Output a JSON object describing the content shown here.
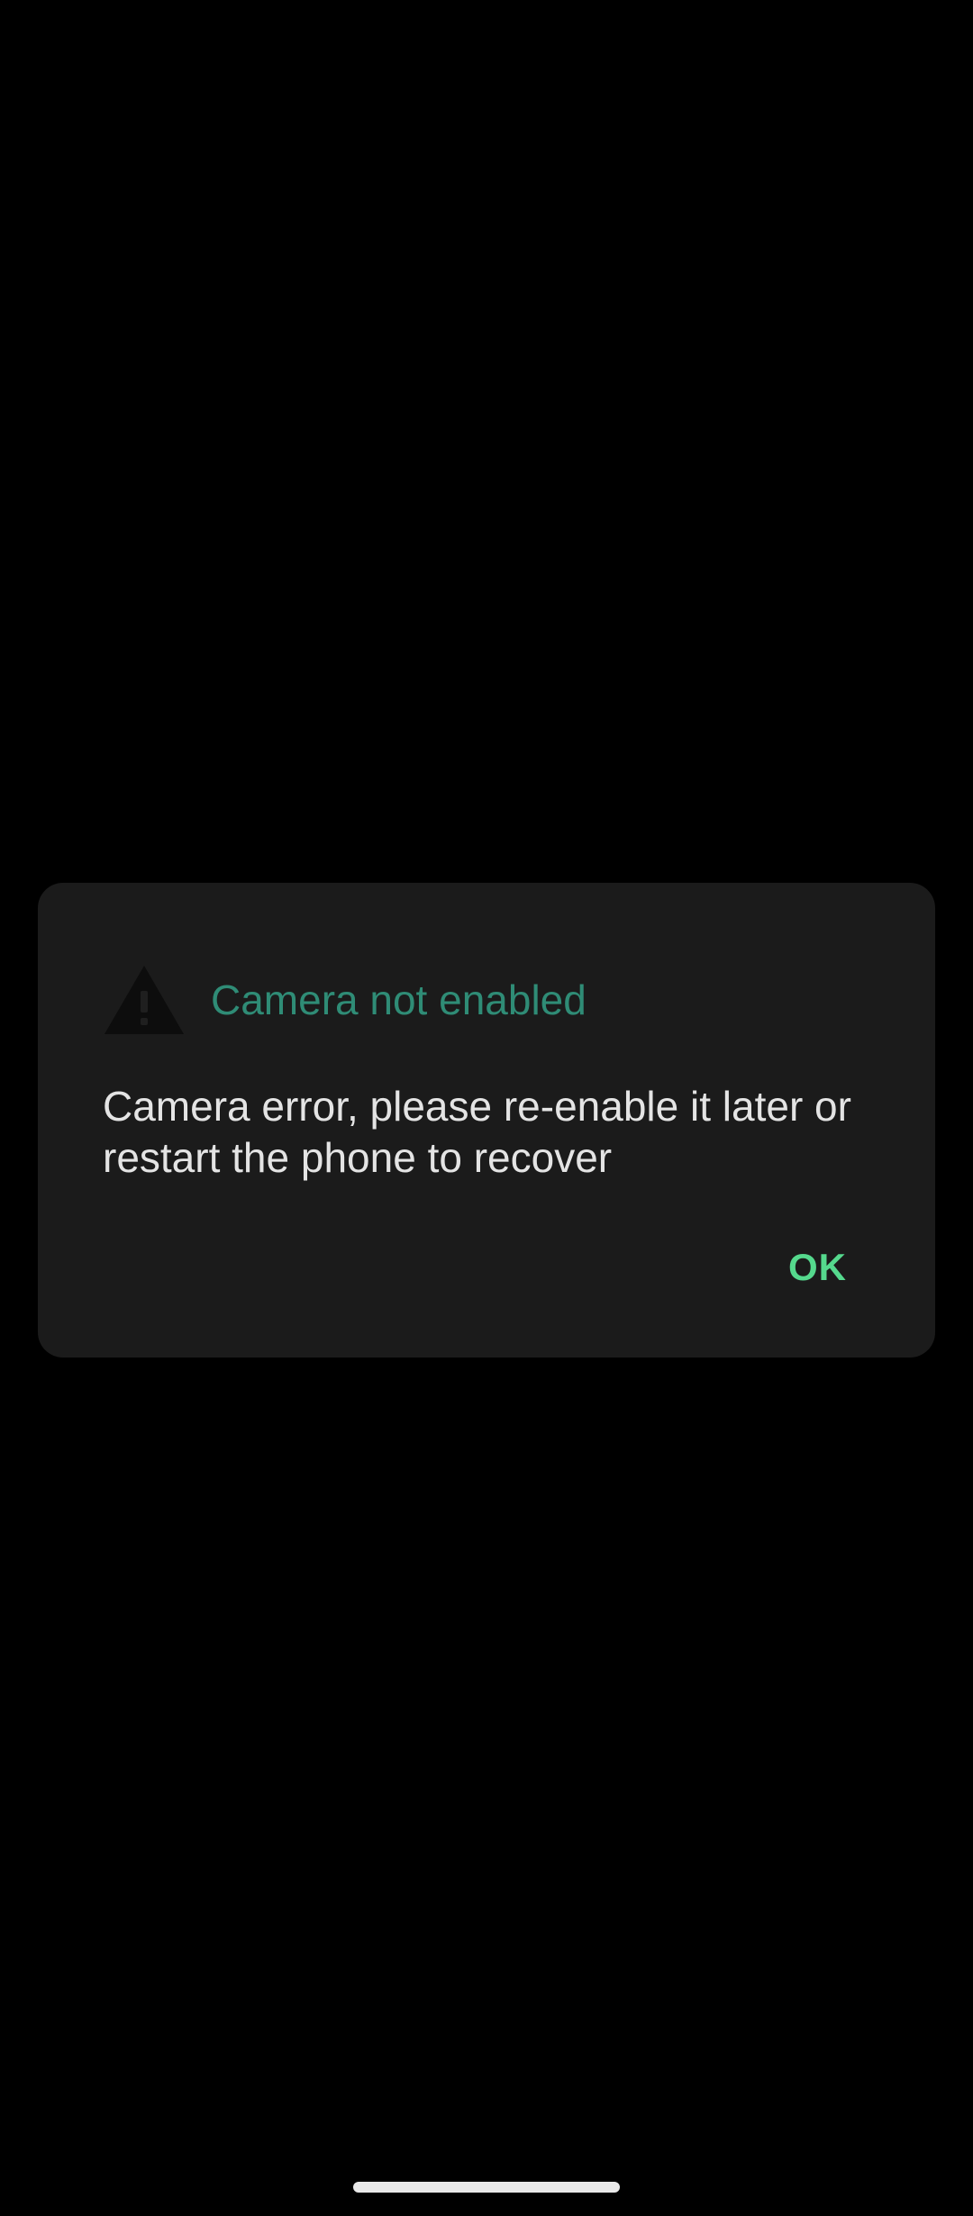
{
  "dialog": {
    "icon": "warning-icon",
    "title": "Camera not enabled",
    "message": "Camera error, please re-enable it later or restart the phone to recover",
    "ok_label": "OK"
  },
  "colors": {
    "background": "#000000",
    "dialog_background": "#1b1b1b",
    "title": "#2f8c76",
    "message": "#e4e4e4",
    "button": "#55d98d",
    "icon": "#0d0d0d"
  }
}
